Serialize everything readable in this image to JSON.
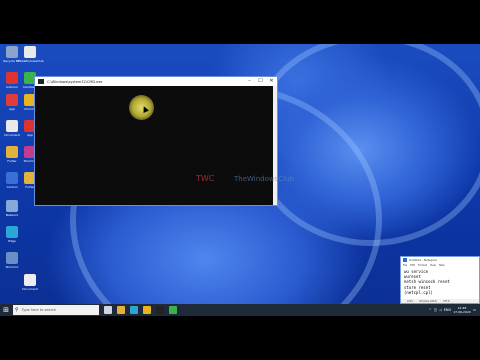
{
  "desktop_icons": [
    {
      "label": "Recycle Bin",
      "icon": "recycle-bin-icon",
      "color": "#8aa3c8"
    },
    {
      "label": "TheWindowsClub",
      "icon": "document-icon",
      "color": "#e9e9e9"
    },
    {
      "label": "Autorun",
      "icon": "app-icon",
      "color": "#d33"
    },
    {
      "label": "Camtasia",
      "icon": "camtasia-icon",
      "color": "#3bb34a"
    },
    {
      "label": "App",
      "icon": "app-icon",
      "color": "#e23b3b"
    },
    {
      "label": "Chrome",
      "icon": "chrome-icon",
      "color": "#e8b420"
    },
    {
      "label": "Document",
      "icon": "document-icon",
      "color": "#e9e9e9"
    },
    {
      "label": "App",
      "icon": "app-icon",
      "color": "#d33"
    },
    {
      "label": "Folder",
      "icon": "folder-icon",
      "color": "#e2b23c"
    },
    {
      "label": "Shortcut",
      "icon": "app-icon",
      "color": "#c33b8f"
    },
    {
      "label": "Control",
      "icon": "control-panel-icon",
      "color": "#3a6fd8"
    },
    {
      "label": "Folder",
      "icon": "folder-icon",
      "color": "#e2b23c"
    },
    {
      "label": "Network",
      "icon": "network-icon",
      "color": "#88a8d8"
    },
    {
      "label": "Edge",
      "icon": "edge-icon",
      "color": "#2aa7d6"
    },
    {
      "label": "Shortcut",
      "icon": "app-icon",
      "color": "#6a8fc8"
    },
    {
      "label": "Document",
      "icon": "document-icon",
      "color": "#ededed"
    }
  ],
  "cmd_window": {
    "title": "C:\\Windows\\system32\\CMD.exe",
    "minimize": "–",
    "maximize": "☐",
    "close": "✕"
  },
  "watermark": {
    "left": "TWC",
    "right": "TheWindowsClub"
  },
  "notepad": {
    "title": "Untitled - Notepad",
    "menu": [
      "File",
      "Edit",
      "Format",
      "View",
      "Help"
    ],
    "lines": [
      "wu service",
      "wureset",
      "netsh winsock reset",
      "store reset",
      "(netcpl.cpl)"
    ],
    "status": [
      "100%",
      "Windows (CRLF)",
      "UTF-8"
    ]
  },
  "taskbar": {
    "search_placeholder": "Type here to search",
    "tray_text": "ENG",
    "time": "12:48",
    "date": "17-06-2020"
  }
}
